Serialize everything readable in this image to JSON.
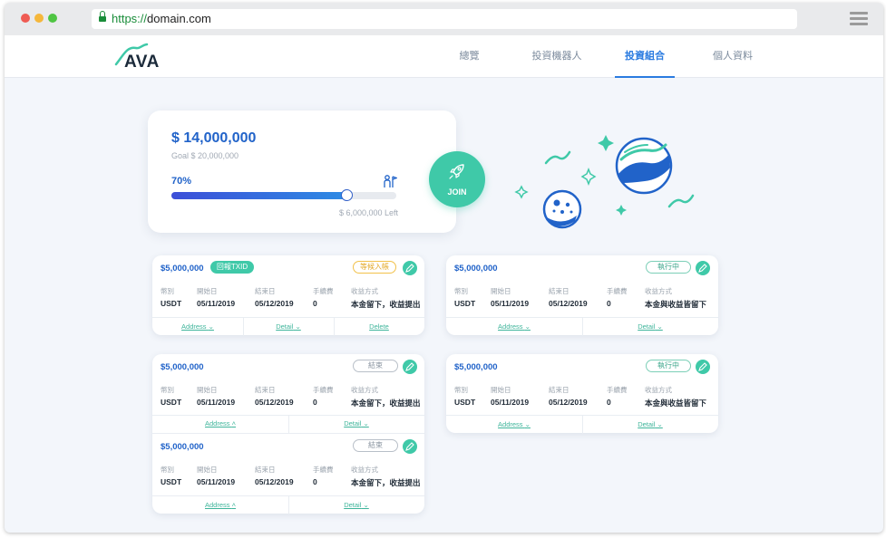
{
  "browser": {
    "url_scheme": "https://",
    "url_host": "domain.com"
  },
  "brand": {
    "name": "AVA",
    "accent": "#3fc9a8",
    "primary": "#2163c9"
  },
  "nav": {
    "items": [
      {
        "label": "總覽",
        "active": false
      },
      {
        "label": "投資機器人",
        "active": false
      },
      {
        "label": "投資組合",
        "active": true
      },
      {
        "label": "個人資料",
        "active": false
      }
    ]
  },
  "goal_card": {
    "amount": "$ 14,000,000",
    "goal": "Goal $ 20,000,000",
    "percent_label": "70%",
    "progress": 0.78,
    "left": "$ 6,000,000 Left",
    "icon": "user-goal-icon"
  },
  "join": {
    "label": "JOIN",
    "icon": "rocket-icon"
  },
  "labels": {
    "currency": "幣別",
    "start": "開始日",
    "end": "結束日",
    "fee": "手續費",
    "method": "收益方式"
  },
  "cards": [
    {
      "amount": "$5,000,000",
      "badge": "回報TXID",
      "status": "等候入帳",
      "currency": "USDT",
      "start": "05/11/2019",
      "end": "05/12/2019",
      "fee": "0",
      "method": "本金留下，收益提出",
      "links": [
        "Address",
        "Detail",
        "Delete"
      ]
    },
    {
      "amount": "$5,000,000",
      "status": "執行中",
      "currency": "USDT",
      "start": "05/11/2019",
      "end": "05/12/2019",
      "fee": "0",
      "method": "本金與收益皆留下",
      "links": [
        "Address",
        "Detail"
      ]
    },
    {
      "amount": "$5,000,000",
      "status": "結束",
      "currency": "USDT",
      "start": "05/11/2019",
      "end": "05/12/2019",
      "fee": "0",
      "method": "本金留下，收益提出",
      "links": [
        "Address",
        "Detail"
      ]
    },
    {
      "amount": "$5,000,000",
      "status": "執行中",
      "currency": "USDT",
      "start": "05/11/2019",
      "end": "05/12/2019",
      "fee": "0",
      "method": "本金與收益皆留下",
      "links": [
        "Address",
        "Detail"
      ]
    },
    {
      "amount": "$5,000,000",
      "status": "結束",
      "currency": "USDT",
      "start": "05/11/2019",
      "end": "05/12/2019",
      "fee": "0",
      "method": "本金留下，收益提出",
      "links": [
        "Address",
        "Detail"
      ]
    }
  ]
}
